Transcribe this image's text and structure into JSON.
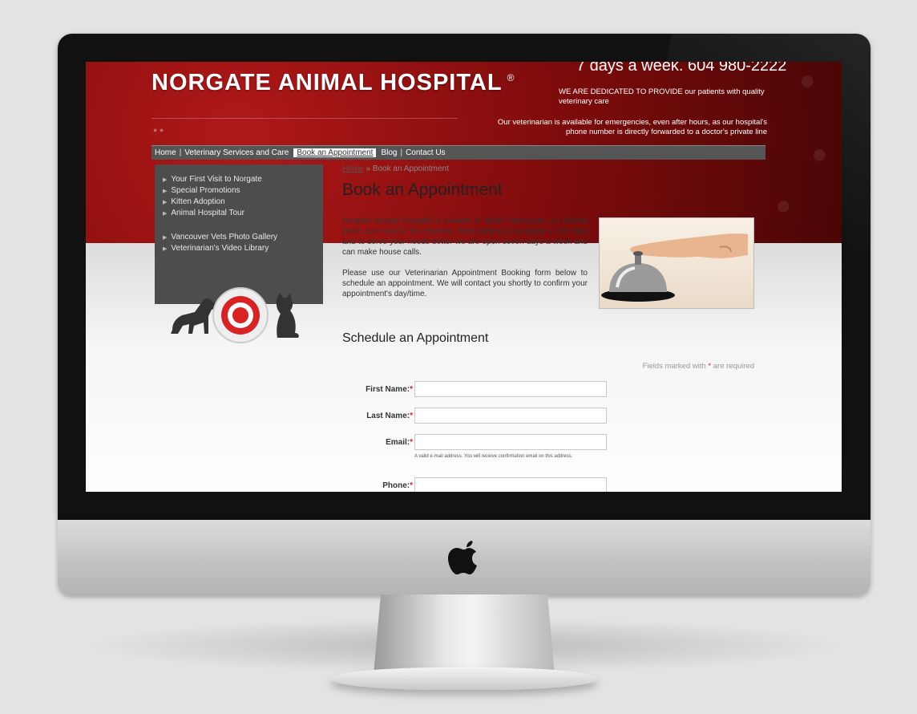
{
  "site": {
    "title": "NORGATE ANIMAL HOSPITAL",
    "title_mark": "®",
    "phone_line": "7 days a week. 604 980-2222",
    "dedicated": "WE ARE DEDICATED TO PROVIDE our patients with quality veterinary care",
    "emergency": "Our veterinarian is available for emergencies, even after hours, as our hospital's phone number is directly forwarded to a doctor's private line"
  },
  "nav": {
    "items": [
      {
        "label": "Home"
      },
      {
        "label": "Veterinary Services and Care"
      },
      {
        "label": "Book an Appointment"
      },
      {
        "label": "Blog"
      },
      {
        "label": "Contact Us"
      }
    ],
    "active": "Book an Appointment"
  },
  "sidebar": {
    "group1": [
      {
        "label": "Your First Visit to Norgate"
      },
      {
        "label": "Special Promotions"
      },
      {
        "label": "Kitten Adoption"
      },
      {
        "label": "Animal Hospital Tour"
      }
    ],
    "group2": [
      {
        "label": "Vancouver Vets Photo Gallery"
      },
      {
        "label": "Veterinarian's Video Library"
      }
    ]
  },
  "breadcrumb": {
    "home": "Home",
    "separator": "»",
    "current": "Book an Appointment"
  },
  "main": {
    "title": "Book an Appointment",
    "paragraph1": "Norgate Animal Hospital is located in North Vancouver, on Marine Drive, just next to Tim Hortons. Free parking is available in the front and to serve your needs better we are open seven days a week and can make house calls.",
    "paragraph2": "Please use our Veterinarian Appointment Booking form below to schedule an appointment. We will contact you shortly to confirm your appointment's day/time.",
    "schedule_title": "Schedule an Appointment"
  },
  "form": {
    "required_note_prefix": "Fields marked with",
    "required_star": "*",
    "required_note_suffix": "are required",
    "fields": [
      {
        "label": "First Name:",
        "value": ""
      },
      {
        "label": "Last Name:",
        "value": ""
      },
      {
        "label": "Email:",
        "value": "",
        "hint": "A valid e-mail address. You will receive confirmation email on this address."
      },
      {
        "label": "Phone:",
        "value": ""
      }
    ]
  },
  "colors": {
    "header_red": "#8f0f0f",
    "nav_gray": "#555555",
    "sidebar_gray": "#4d4d4d",
    "required_red": "#dd2222"
  },
  "icons": {
    "os_logo": "apple-logo-icon",
    "nav_arrow": "triangle-right-icon",
    "mascot": "dog-cat-emblem-icon"
  }
}
